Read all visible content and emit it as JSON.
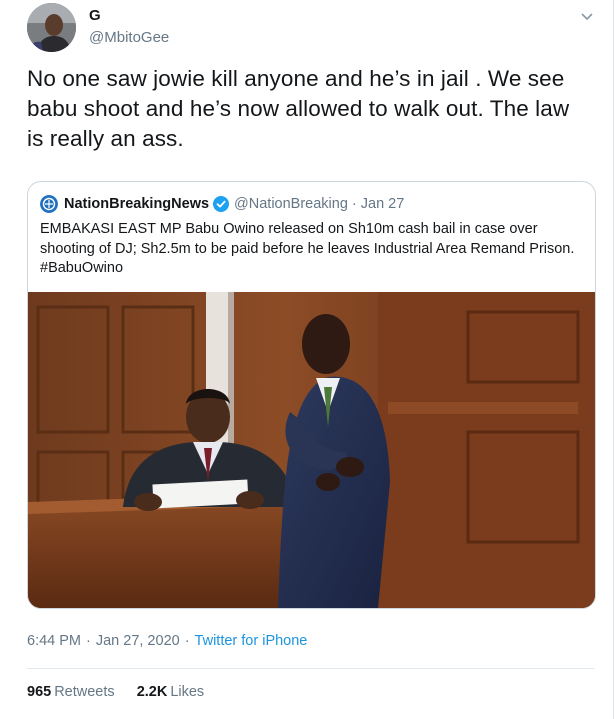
{
  "author": {
    "display_name": "G",
    "handle": "@MbitoGee"
  },
  "tweet": {
    "text": "No one saw jowie kill anyone and he’s in jail . We see babu shoot and he’s now allowed to walk out. The law is really an ass."
  },
  "quoted_tweet": {
    "name": "NationBreakingNews",
    "handle": "@NationBreaking",
    "dot": "·",
    "date": "Jan 27",
    "text_lines": [
      "EMBAKASI EAST MP Babu Owino released on Sh10m cash bail in case over",
      "shooting of DJ; Sh2.5m to be paid before he leaves Industrial Area Remand Prison.",
      "#BabuOwino"
    ]
  },
  "meta": {
    "time": "6:44 PM",
    "sep": "·",
    "date": "Jan 27, 2020",
    "source": "Twitter for iPhone"
  },
  "stats": {
    "retweets_count": "965",
    "retweets_label": "Retweets",
    "likes_count": "2.2K",
    "likes_label": "Likes"
  },
  "colors": {
    "link": "#1b95e0",
    "secondary_text": "#657786",
    "verified": "#1da1f2",
    "border": "#e1e8ed"
  },
  "icons": {
    "caret": "chevron-down-icon",
    "verified": "verified-badge-icon"
  }
}
